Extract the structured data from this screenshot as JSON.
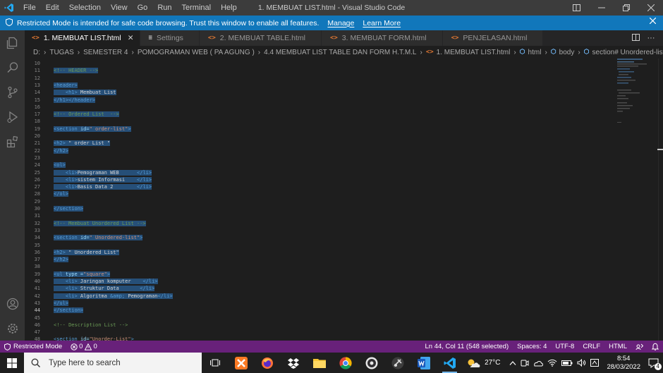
{
  "window": {
    "title": "1. MEMBUAT LIST.html - Visual Studio Code"
  },
  "menu": [
    "File",
    "Edit",
    "Selection",
    "View",
    "Go",
    "Run",
    "Terminal",
    "Help"
  ],
  "banner": {
    "text": "Restricted Mode is intended for safe code browsing. Trust this window to enable all features.",
    "manage": "Manage",
    "learn_more": "Learn More"
  },
  "tabs": [
    {
      "label": "1. MEMBUAT LIST.html",
      "icon": "html-file-icon",
      "active": true
    },
    {
      "label": "Settings",
      "icon": "settings-file-icon",
      "active": false
    },
    {
      "label": "2. MEMBUAT TABLE.html",
      "icon": "html-file-icon",
      "active": false
    },
    {
      "label": "3. MEMBUAT FORM.html",
      "icon": "html-file-icon",
      "active": false
    },
    {
      "label": "PENJELASAN.html",
      "icon": "html-file-icon",
      "active": false
    }
  ],
  "breadcrumb": [
    "D:",
    "TUGAS",
    "SEMESTER 4",
    "POMOGRAMAN WEB ( PA AGUNG )",
    "4.4 MEMBUAT LIST TABLE DAN FORM H.T.M.L",
    "1. MEMBUAT LIST.html",
    "html",
    "body",
    "section# Unordered-list"
  ],
  "editor": {
    "lines": [
      {
        "n": "10",
        "segs": []
      },
      {
        "n": "11",
        "segs": [
          {
            "t": "<!-- HEADER -->",
            "c": "com",
            "s": true
          }
        ]
      },
      {
        "n": "12",
        "segs": []
      },
      {
        "n": "13",
        "segs": [
          {
            "t": "<header>",
            "c": "tag",
            "s": true
          }
        ]
      },
      {
        "n": "14",
        "segs": [
          {
            "t": "    ",
            "c": "txt",
            "s": true
          },
          {
            "t": "<h1>",
            "c": "tag",
            "s": true
          },
          {
            "t": " Membuat List",
            "c": "txt",
            "s": true
          }
        ]
      },
      {
        "n": "15",
        "segs": [
          {
            "t": "</h1></header>",
            "c": "tag",
            "s": true
          }
        ]
      },
      {
        "n": "16",
        "segs": []
      },
      {
        "n": "17",
        "segs": [
          {
            "t": "<!-- Ordered List  -->",
            "c": "com",
            "s": true
          }
        ]
      },
      {
        "n": "18",
        "segs": []
      },
      {
        "n": "19",
        "segs": [
          {
            "t": "<section ",
            "c": "tag",
            "s": true
          },
          {
            "t": "id=",
            "c": "attr",
            "s": true
          },
          {
            "t": "\" order-list\"",
            "c": "str",
            "s": true
          },
          {
            "t": ">",
            "c": "tag",
            "s": true
          }
        ]
      },
      {
        "n": "20",
        "segs": []
      },
      {
        "n": "21",
        "segs": [
          {
            "t": "<h2>",
            "c": "tag",
            "s": true
          },
          {
            "t": " \" order List \"",
            "c": "txt",
            "s": true
          }
        ]
      },
      {
        "n": "22",
        "segs": [
          {
            "t": "</h2>",
            "c": "tag",
            "s": true
          }
        ]
      },
      {
        "n": "23",
        "segs": []
      },
      {
        "n": "24",
        "segs": [
          {
            "t": "<ol>",
            "c": "tag",
            "s": true
          }
        ]
      },
      {
        "n": "25",
        "segs": [
          {
            "t": "    ",
            "c": "txt",
            "s": true
          },
          {
            "t": "<li>",
            "c": "tag",
            "s": true
          },
          {
            "t": "Pemograman WEB      ",
            "c": "txt",
            "s": true
          },
          {
            "t": "</li>",
            "c": "tag",
            "s": true
          }
        ]
      },
      {
        "n": "26",
        "segs": [
          {
            "t": "    ",
            "c": "txt",
            "s": true
          },
          {
            "t": "<li>",
            "c": "tag",
            "s": true
          },
          {
            "t": "sistem Informasi    ",
            "c": "txt",
            "s": true
          },
          {
            "t": "</li>",
            "c": "tag",
            "s": true
          }
        ]
      },
      {
        "n": "27",
        "segs": [
          {
            "t": "    ",
            "c": "txt",
            "s": true
          },
          {
            "t": "<li>",
            "c": "tag",
            "s": true
          },
          {
            "t": "Basis Data 2        ",
            "c": "txt",
            "s": true
          },
          {
            "t": "</li>",
            "c": "tag",
            "s": true
          }
        ]
      },
      {
        "n": "28",
        "segs": [
          {
            "t": "</ol>",
            "c": "tag",
            "s": true
          }
        ]
      },
      {
        "n": "29",
        "segs": []
      },
      {
        "n": "30",
        "segs": [
          {
            "t": "</section>",
            "c": "tag",
            "s": true
          }
        ]
      },
      {
        "n": "31",
        "segs": []
      },
      {
        "n": "32",
        "segs": [
          {
            "t": "<!-- Membuat Unordered List -->",
            "c": "com",
            "s": true
          }
        ]
      },
      {
        "n": "33",
        "segs": []
      },
      {
        "n": "34",
        "segs": [
          {
            "t": "<section ",
            "c": "tag",
            "s": true
          },
          {
            "t": "id=",
            "c": "attr",
            "s": true
          },
          {
            "t": "\" Unordered-list\"",
            "c": "str",
            "s": true
          },
          {
            "t": ">",
            "c": "tag",
            "s": true
          }
        ]
      },
      {
        "n": "35",
        "segs": []
      },
      {
        "n": "36",
        "segs": [
          {
            "t": "<h2>",
            "c": "tag",
            "s": true
          },
          {
            "t": " \" Unordered List\"",
            "c": "txt",
            "s": true
          }
        ]
      },
      {
        "n": "37",
        "segs": [
          {
            "t": "</h2>",
            "c": "tag",
            "s": true
          }
        ]
      },
      {
        "n": "38",
        "segs": []
      },
      {
        "n": "39",
        "segs": [
          {
            "t": "<ul ",
            "c": "tag",
            "s": true
          },
          {
            "t": "type =",
            "c": "attr",
            "s": true
          },
          {
            "t": "\"square\"",
            "c": "str",
            "s": true
          },
          {
            "t": ">",
            "c": "tag",
            "s": true
          }
        ]
      },
      {
        "n": "40",
        "segs": [
          {
            "t": "    ",
            "c": "txt",
            "s": true
          },
          {
            "t": "<li>",
            "c": "tag",
            "s": true
          },
          {
            "t": " Jaringan komputer    ",
            "c": "txt",
            "s": true
          },
          {
            "t": "</li>",
            "c": "tag",
            "s": true
          }
        ]
      },
      {
        "n": "41",
        "segs": [
          {
            "t": "    ",
            "c": "txt",
            "s": true
          },
          {
            "t": "<li>",
            "c": "tag",
            "s": true
          },
          {
            "t": " Struktur Data       ",
            "c": "txt",
            "s": true
          },
          {
            "t": "</li>",
            "c": "tag",
            "s": true
          }
        ]
      },
      {
        "n": "42",
        "segs": [
          {
            "t": "    ",
            "c": "txt",
            "s": true
          },
          {
            "t": "<li>",
            "c": "tag",
            "s": true
          },
          {
            "t": " Algoritma ",
            "c": "txt",
            "s": true
          },
          {
            "t": "&amp;",
            "c": "tag",
            "s": true
          },
          {
            "t": " Pemograman",
            "c": "txt",
            "s": true
          },
          {
            "t": "</li>",
            "c": "tag",
            "s": true
          }
        ]
      },
      {
        "n": "43",
        "segs": [
          {
            "t": "</ul>",
            "c": "tag",
            "s": true
          }
        ]
      },
      {
        "n": "44",
        "segs": [
          {
            "t": "</section>",
            "c": "tag",
            "s": true
          }
        ],
        "current": true
      },
      {
        "n": "45",
        "segs": []
      },
      {
        "n": "46",
        "segs": [
          {
            "t": "<!-- Description List -->",
            "c": "com",
            "s": false
          }
        ]
      },
      {
        "n": "47",
        "segs": []
      },
      {
        "n": "48",
        "segs": [
          {
            "t": "<section ",
            "c": "tag",
            "s": false
          },
          {
            "t": "id=",
            "c": "attr",
            "s": false
          },
          {
            "t": "\"Unorder-List\"",
            "c": "str",
            "s": false
          },
          {
            "t": ">",
            "c": "tag",
            "s": false
          }
        ]
      }
    ]
  },
  "statusbar": {
    "restricted": "Restricted Mode",
    "errors": "0",
    "warnings": "0",
    "position": "Ln 44, Col 11 (548 selected)",
    "spaces": "Spaces: 4",
    "encoding": "UTF-8",
    "eol": "CRLF",
    "language": "HTML"
  },
  "taskbar": {
    "search_placeholder": "Type here to search",
    "weather": "27°C",
    "time": "8:54",
    "date": "28/03/2022",
    "notification_count": "4"
  },
  "colors": {
    "banner": "#1177bb",
    "statusbar": "#68217a",
    "selection": "#264f78",
    "html_icon": "#e37933"
  }
}
